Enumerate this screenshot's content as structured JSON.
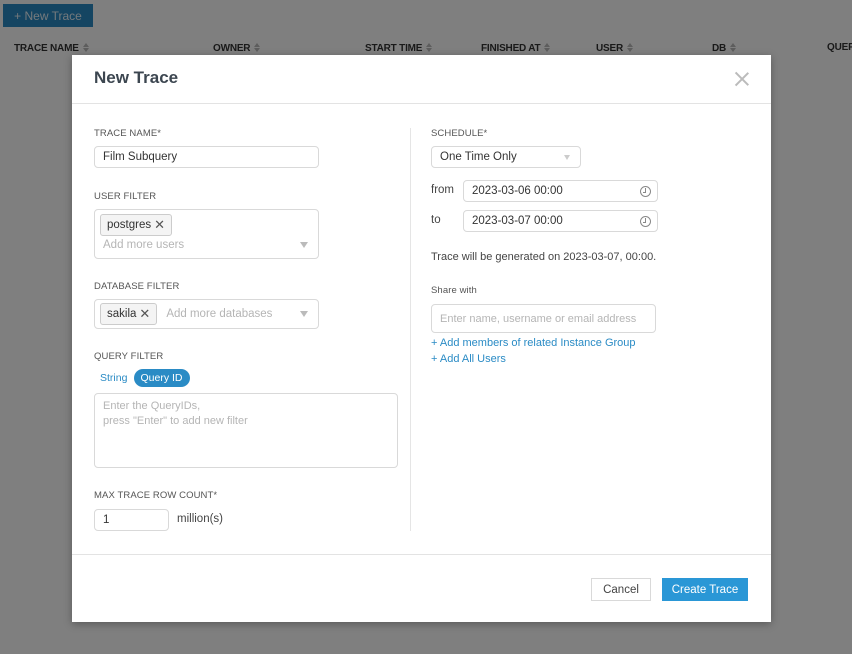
{
  "background": {
    "new_trace_button": "+ New Trace",
    "columns": [
      {
        "label": "TRACE NAME"
      },
      {
        "label": "OWNER"
      },
      {
        "label": "START TIME"
      },
      {
        "label": "FINISHED AT"
      },
      {
        "label": "USER"
      },
      {
        "label": "DB"
      },
      {
        "label": "QUER"
      }
    ]
  },
  "modal": {
    "title": "New Trace",
    "trace_name": {
      "label": "TRACE NAME*",
      "value": "Film Subquery"
    },
    "user_filter": {
      "label": "USER FILTER",
      "tags": [
        "postgres"
      ],
      "placeholder": "Add more users"
    },
    "database_filter": {
      "label": "DATABASE FILTER",
      "tags": [
        "sakila"
      ],
      "placeholder": "Add more databases"
    },
    "query_filter": {
      "label": "QUERY FILTER",
      "modes": [
        "String",
        "Query ID"
      ],
      "active_mode": "Query ID",
      "placeholder_line1": "Enter the QueryIDs,",
      "placeholder_line2": "press \"Enter\" to add new filter"
    },
    "max_row_count": {
      "label": "MAX TRACE ROW COUNT*",
      "value": "1",
      "unit": "million(s)"
    },
    "schedule": {
      "label": "SCHEDULE*",
      "selected": "One Time Only",
      "from_label": "from",
      "from_value": "2023-03-06 00:00",
      "to_label": "to",
      "to_value": "2023-03-07 00:00",
      "generated_note": "Trace will be generated on 2023-03-07, 00:00."
    },
    "share": {
      "label": "Share with",
      "placeholder": "Enter name, username or email address",
      "add_group_link": "+ Add members of related Instance Group",
      "add_all_link": "+ Add All Users"
    },
    "buttons": {
      "cancel": "Cancel",
      "create": "Create Trace"
    }
  },
  "colors": {
    "accent": "#2a97d6",
    "overlay": "rgba(0,0,0,0.5)"
  }
}
